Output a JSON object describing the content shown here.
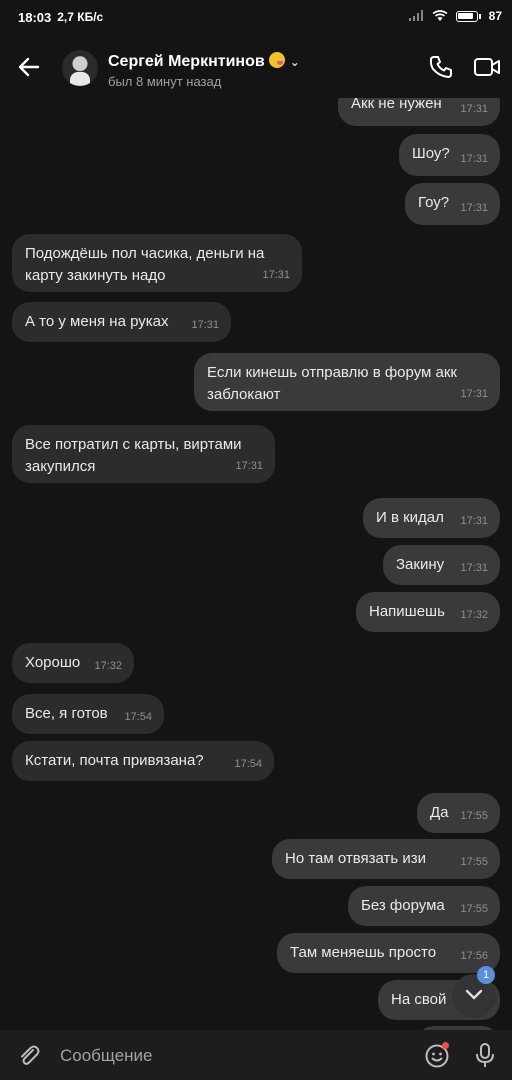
{
  "status_bar": {
    "time": "18:03",
    "speed": "2,7 КБ/с",
    "battery": "87"
  },
  "header": {
    "name": "Сергей Меркнтинов",
    "last_seen": "был 8 минут назад"
  },
  "messages": [
    {
      "dir": "out",
      "text": "Акк не нужен",
      "time": "17:31"
    },
    {
      "dir": "out",
      "text": "Шоу?",
      "time": "17:31"
    },
    {
      "dir": "out",
      "text": "Гоу?",
      "time": "17:31"
    },
    {
      "dir": "in",
      "text": "Подождёшь пол часика, деньги на",
      "text2": "карту закинуть надо",
      "time": "17:31"
    },
    {
      "dir": "in",
      "text": "А то у меня на руках",
      "time": "17:31"
    },
    {
      "dir": "out",
      "text": "Если  кинешь отправлю в форум акк",
      "text2": "заблокают",
      "time": "17:31"
    },
    {
      "dir": "in",
      "text": "Все потратил с карты, виртами",
      "text2": "закупился",
      "time": "17:31"
    },
    {
      "dir": "out",
      "text": "И в кидал",
      "time": "17:31"
    },
    {
      "dir": "out",
      "text": "Закину",
      "time": "17:31"
    },
    {
      "dir": "out",
      "text": "Напишешь",
      "time": "17:32"
    },
    {
      "dir": "in",
      "text": "Хорошо",
      "time": "17:32"
    },
    {
      "dir": "in",
      "text": "Все, я готов",
      "time": "17:54"
    },
    {
      "dir": "in",
      "text": "Кстати, почта привязана?",
      "time": "17:54"
    },
    {
      "dir": "out",
      "text": "Да",
      "time": "17:55"
    },
    {
      "dir": "out",
      "text": "Но там отвязать изи",
      "time": "17:55"
    },
    {
      "dir": "out",
      "text": "Без форума",
      "time": "17:55"
    },
    {
      "dir": "out",
      "text": "Там меняешь просто",
      "time": "17:56"
    },
    {
      "dir": "out",
      "text": "На свой",
      "time": ""
    }
  ],
  "scroll": {
    "unread_count": "1"
  },
  "composer": {
    "placeholder": "Сообщение"
  },
  "colors": {
    "background": "#141414",
    "bubble_in": "#2c2c2e",
    "bubble_out": "#3a3a3c",
    "accent": "#5b8fd9"
  }
}
